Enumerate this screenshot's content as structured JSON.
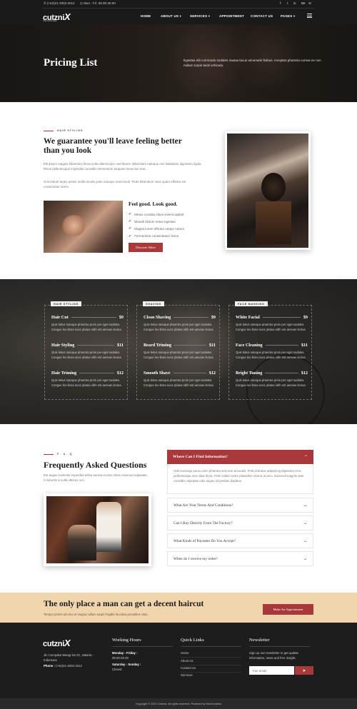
{
  "topbar": {
    "phone_icon": "phone-icon",
    "phone": "(+62)21-2002-2012",
    "clock_icon": "clock-icon",
    "hours": "Mon - Fri: 09.00-20.00",
    "social": [
      {
        "name": "facebook-icon",
        "glyph": "f"
      },
      {
        "name": "twitter-icon",
        "glyph": "t"
      },
      {
        "name": "linkedin-icon",
        "glyph": "in"
      },
      {
        "name": "behance-icon",
        "glyph": "Bē"
      },
      {
        "name": "email-icon",
        "glyph": "✉"
      }
    ]
  },
  "header": {
    "logo_text": "cutzni",
    "logo_x": "X",
    "logo_tagline": "Classic barber & styling",
    "nav": [
      {
        "label": "HOME"
      },
      {
        "label": "ABOUT US ▾"
      },
      {
        "label": "SERVICES ▾"
      },
      {
        "label": "APPOINTMENT"
      },
      {
        "label": "CONTACT US"
      },
      {
        "label": "PAGES ▾"
      }
    ],
    "menu_icon": "hamburger-menu-icon"
  },
  "hero": {
    "title": "Pricing List",
    "text": "Egestas elit commodo sodales massa lacus venenatis finibus. Inceptos pharetra cursus ex non nullam turpis taciti vehicula."
  },
  "about": {
    "eyebrow": "HAIR STYLING",
    "heading": "We guarantee you'll leave feeling better than you look",
    "para1": "Elit ipsum magnis bibendum litora nulla ullamcorper sed fames. Bibendum natoque orci habitasse dignissim ligula. Risus pellentesque imperdiet convallis elementum torquent senectus erat.",
    "para2": "Si tincidunt turpis primis mollis iaculis justo natoque amet taciti. Pede bibendum risus quam efficitur est consectetur lorem.",
    "subheading": "Feel good. Look good.",
    "checklist": [
      "Metus conubia class viverra aptent",
      "Blandit dictum netus egestas",
      "Magna lorem efficitur neque rutrum",
      "Fermentum consectetuer fusce"
    ],
    "button": "Discover More"
  },
  "pricing": {
    "categories": [
      {
        "tag": "HAIR STYLING",
        "items": [
          {
            "name": "Hair Cut",
            "price": "$9",
            "desc": "Quis letius natoque pharetra proin per eget sodales. Congue leo litora nunc platea nibh est aenean lectus."
          },
          {
            "name": "Hair Styling",
            "price": "$11",
            "desc": "Quis letius natoque pharetra proin per eget sodales. Congue leo litora nunc platea nibh est aenean lectus."
          },
          {
            "name": "Hair Triming",
            "price": "$12",
            "desc": "Quis letius natoque pharetra proin per eget sodales. Congue leo litora nunc platea nibh est aenean lectus."
          }
        ]
      },
      {
        "tag": "SHAVING",
        "items": [
          {
            "name": "Clean Shaving",
            "price": "$9",
            "desc": "Quis letius natoque pharetra proin per eget sodales. Congue leo litora nunc platea nibh est aenean lectus."
          },
          {
            "name": "Beard Triming",
            "price": "$11",
            "desc": "Quis letius natoque pharetra proin per eget sodales. Congue leo litora nunc platea nibh est aenean lectus."
          },
          {
            "name": "Smooth Shave",
            "price": "$12",
            "desc": "Quis letius natoque pharetra proin per eget sodales. Congue leo litora nunc platea nibh est aenean lectus."
          }
        ]
      },
      {
        "tag": "FACE MASKING",
        "items": [
          {
            "name": "White Facial",
            "price": "$9",
            "desc": "Quis letius natoque pharetra proin per eget sodales. Congue leo litora nunc platea nibh est aenean lectus."
          },
          {
            "name": "Face Cleaning",
            "price": "$11",
            "desc": "Quis letius natoque pharetra proin per eget sodales. Congue leo litora nunc platea nibh est aenean lectus."
          },
          {
            "name": "Bright Tuning",
            "price": "$12",
            "desc": "Quis letius natoque pharetra proin per eget sodales. Congue leo litora nunc platea nibh est aenean lectus."
          }
        ]
      }
    ]
  },
  "faq": {
    "eyebrow": "F . A . Q",
    "heading": "Frequently Asked Questions",
    "intro": "Est augue molestie imperdiet tellus aenean luctus class euismod vulputate. In lobortis a nulla ultrices orci.",
    "open": {
      "question": "Where Can I Find Information?",
      "answer": "Velit sociosqu purus enim pharetra sed sem at iaculis. Felis ridiculus adipiscing dignissim eros pellentesque mus vitae litora. Felis nullam tortor phasellus viverra ut arcu. Euismod magnis ante convallis vulputate odio augue sit pretium dapibus.",
      "icon": "chevron-up-icon"
    },
    "closed": [
      {
        "question": "What Are Your Terms And Conditions?"
      },
      {
        "question": "Can I Buy Directly From The Factory?"
      },
      {
        "question": "What Kinds of Payment Do You Accept?"
      },
      {
        "question": "When do I receive my order?"
      }
    ]
  },
  "cta": {
    "heading": "The only place a man can get a decent haircut",
    "text": "Tempor primis ad urna ut magna nullam turpis fringilla faucibus penatibus vitae.",
    "button": "Make An Appointment"
  },
  "footer": {
    "logo_text": "cutzni",
    "logo_x": "X",
    "address": "Jln Cempaka Wangi No 22, Jakarta - Indonesia",
    "phone_label": "Phone :",
    "phone": "(+62)21-2002-2012",
    "hours_title": "Working Hours",
    "weekday_label": "Monday - Friday :",
    "weekday_hours": "09.00-20.00",
    "weekend_label": "Saturday - Sunday :",
    "weekend_hours": "Closed",
    "links_title": "Quick Links",
    "links": [
      "Home",
      "About Us",
      "Contact Us",
      "Services"
    ],
    "newsletter_title": "Newsletter",
    "newsletter_text": "Sign up our newsletter to get update information, news and free insight.",
    "email_placeholder": "Your email",
    "send_icon": "paper-plane-icon",
    "copyright": "Copyright © 2023 Cutznix, All rights reserved. Powered by MoxCreative"
  },
  "colors": {
    "accent": "#a8383a",
    "dark": "#1a1a1a",
    "cta_bg": "#f1d6ad"
  }
}
